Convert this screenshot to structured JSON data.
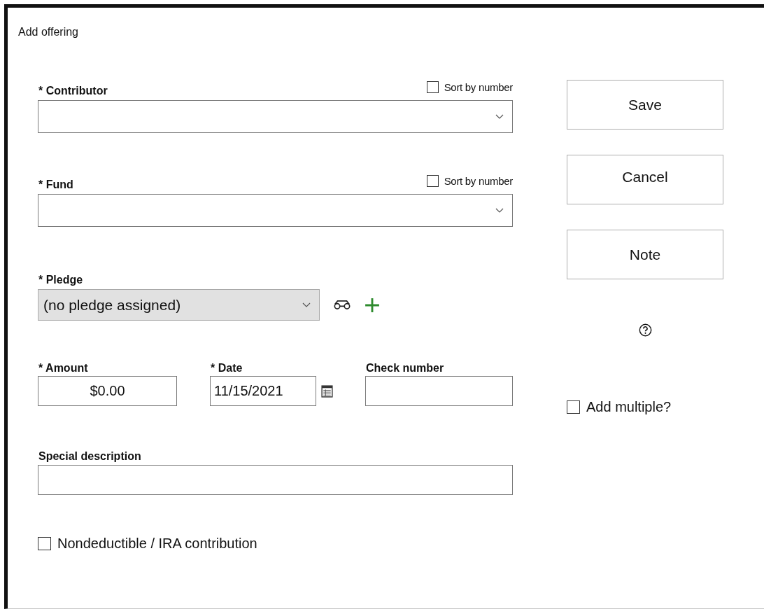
{
  "window": {
    "title": "Add offering"
  },
  "combos": [
    {
      "label": "* Contributor",
      "sort": {
        "label": "Sort by number",
        "checked": false
      }
    },
    {
      "label": "* Fund",
      "sort": {
        "label": "Sort by number",
        "checked": false
      }
    }
  ],
  "pledge": {
    "label": "* Pledge",
    "value": "(no pledge assigned)",
    "disabled": true
  },
  "amount": {
    "label": "* Amount",
    "value": "$0.00"
  },
  "date": {
    "label": "* Date",
    "value": "11/15/2021"
  },
  "check_number": {
    "label": "Check number"
  },
  "special_description": {
    "label": "Special description"
  },
  "nondeductible": {
    "label": "Nondeductible / IRA contribution",
    "checked": false
  },
  "buttons": [
    "Save",
    "Cancel",
    "Note"
  ],
  "add_multiple": {
    "label": "Add multiple?",
    "checked": false
  }
}
